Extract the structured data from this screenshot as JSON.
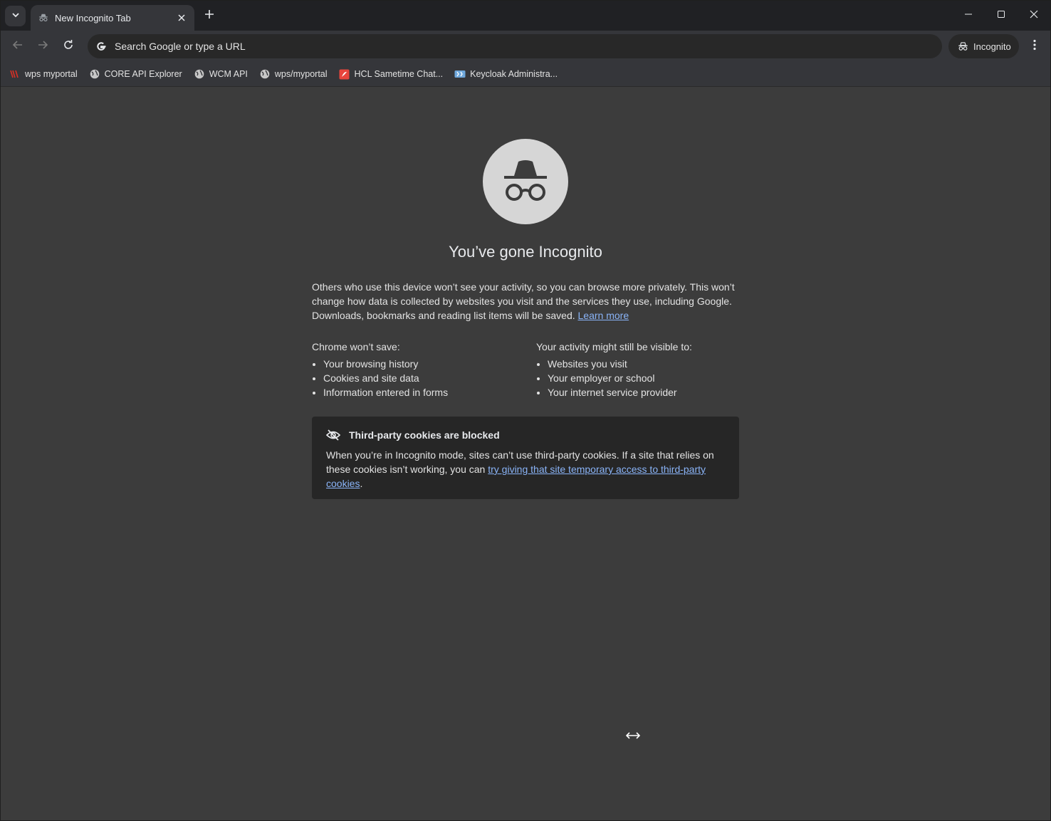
{
  "tabstrip": {
    "tab_title": "New Incognito Tab",
    "icons": {
      "tab_search": "chevron-down-icon",
      "tab_favicon": "incognito-icon",
      "tab_close": "close-icon",
      "new_tab": "plus-icon",
      "minimize": "minimize-icon",
      "maximize": "maximize-icon",
      "close": "close-icon"
    }
  },
  "toolbar": {
    "omnibox_placeholder": "Search Google or type a URL",
    "incognito_label": "Incognito",
    "icons": {
      "back": "arrow-left-icon",
      "forward": "arrow-right-icon",
      "reload": "reload-icon",
      "google": "google-g-icon",
      "menu": "more-vertical-icon"
    }
  },
  "bookmarks": [
    {
      "label": "wps myportal",
      "icon": "hcl-logo-icon"
    },
    {
      "label": "CORE API Explorer",
      "icon": "globe-icon"
    },
    {
      "label": "WCM API",
      "icon": "globe-icon"
    },
    {
      "label": "wps/myportal",
      "icon": "globe-icon"
    },
    {
      "label": "HCL Sametime Chat...",
      "icon": "sametime-icon"
    },
    {
      "label": "Keycloak Administra...",
      "icon": "keycloak-icon"
    }
  ],
  "page": {
    "headline": "You’ve gone Incognito",
    "intro_text": "Others who use this device won’t see your activity, so you can browse more privately. This won’t change how data is collected by websites you visit and the services they use, including Google. Downloads, bookmarks and reading list items will be saved.",
    "learn_more": "Learn more",
    "wont_save": {
      "title": "Chrome won’t save:",
      "items": [
        "Your browsing history",
        "Cookies and site data",
        "Information entered in forms"
      ]
    },
    "might_be_visible": {
      "title": "Your activity might still be visible to:",
      "items": [
        "Websites you visit",
        "Your employer or school",
        "Your internet service provider"
      ]
    },
    "cookie_card": {
      "title": "Third-party cookies are blocked",
      "body_prefix": "When you’re in Incognito mode, sites can’t use third-party cookies. If a site that relies on these cookies isn’t working, you can",
      "link_text": "try giving that site temporary access to third-party cookies",
      "body_suffix": ".",
      "icon": "eye-off-icon"
    }
  },
  "colors": {
    "background": "#3c3c3c",
    "toolbar": "#35363a",
    "tabstrip": "#202124",
    "link": "#8ab4f8",
    "card": "#262626"
  }
}
